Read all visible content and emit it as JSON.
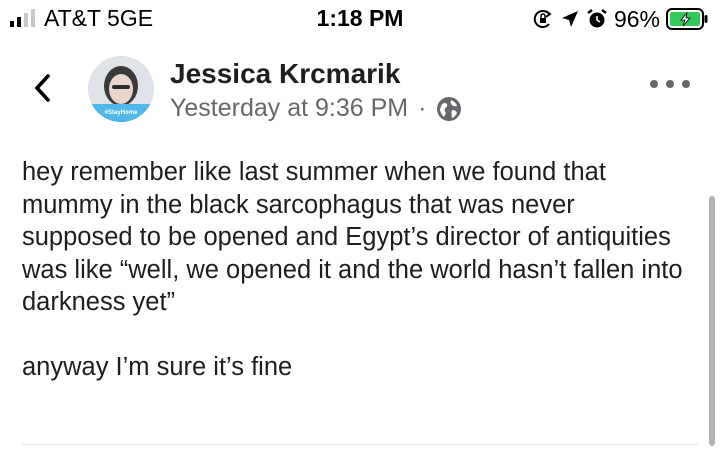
{
  "status_bar": {
    "carrier": "AT&T  5GE",
    "time": "1:18 PM",
    "battery_percent": "96%",
    "icons": [
      "signal-bars-icon",
      "screen-lock-rotation-icon",
      "location-arrow-icon",
      "alarm-icon",
      "battery-charging-icon"
    ]
  },
  "post": {
    "author": "Jessica Krcmarik",
    "timestamp": "Yesterday at 9:36 PM",
    "separator": "·",
    "audience_icon": "globe-icon",
    "avatar_caption": "#StayHome",
    "text": "hey remember like last summer when we found that mummy in the black sarcophagus that was never supposed to be opened and Egypt’s director of antiquities was like “well, we opened it and the world hasn’t fallen into darkness yet”\n\nanyway I’m sure it’s fine"
  },
  "colors": {
    "text": "#1c1e21",
    "secondary": "#65676b",
    "battery_green": "#34c759",
    "avatar_frame": "#4fb8e8"
  }
}
